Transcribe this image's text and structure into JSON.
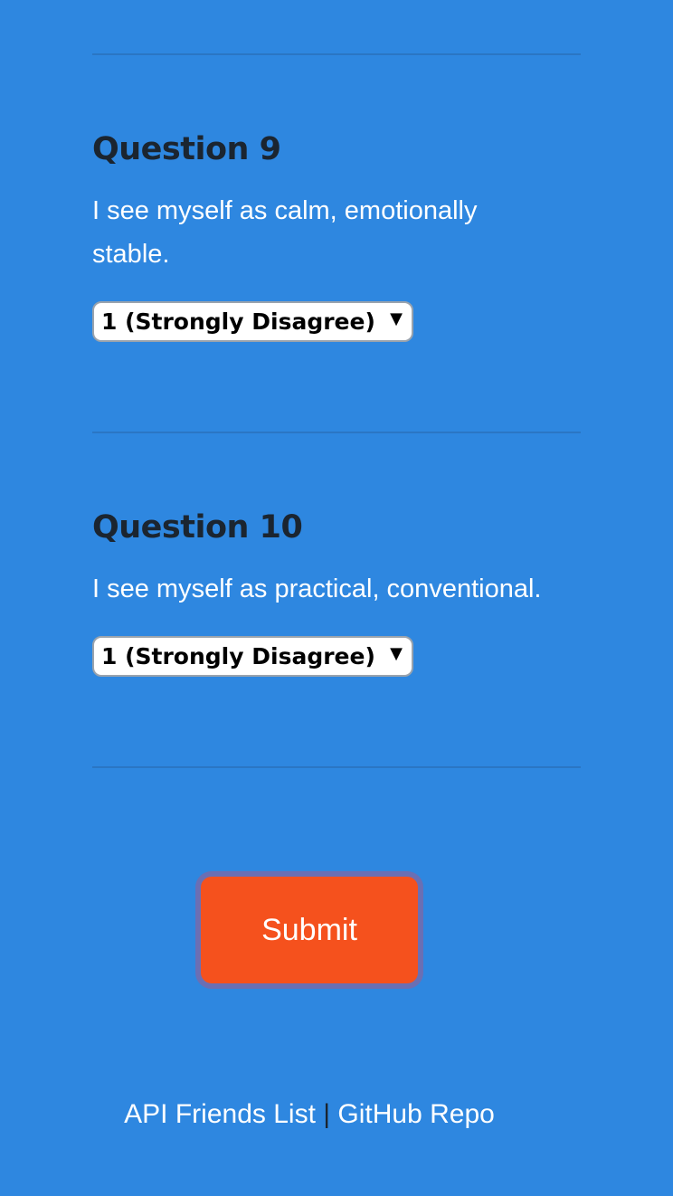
{
  "questions": [
    {
      "title": "Question 9",
      "text": "I see myself as calm, emotionally stable.",
      "selected": "1 (Strongly Disagree)"
    },
    {
      "title": "Question 10",
      "text": "I see myself as practical, conventional.",
      "selected": "1 (Strongly Disagree)"
    }
  ],
  "select_arrow": "▼",
  "submit_label": "Submit",
  "footer": {
    "link1": "API Friends List",
    "separator": "|",
    "link2": "GitHub Repo"
  },
  "colors": {
    "background": "#2e87e0",
    "submit": "#f5511d",
    "heading": "#1b2530"
  }
}
